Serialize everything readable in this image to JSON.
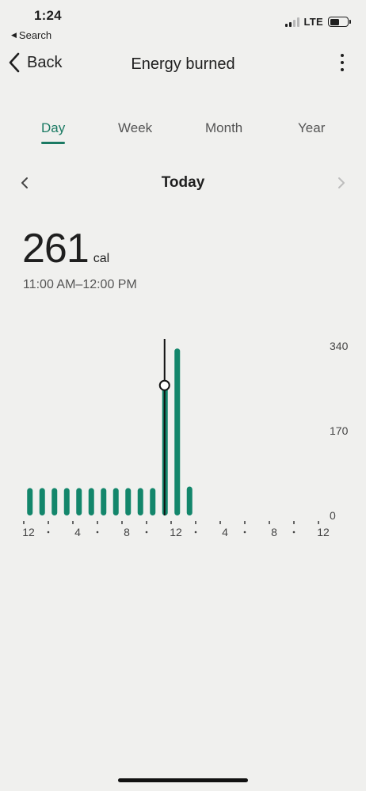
{
  "status_bar": {
    "time": "1:24",
    "back_app": "Search",
    "network": "LTE"
  },
  "header": {
    "back_label": "Back",
    "title": "Energy burned"
  },
  "tabs": [
    {
      "label": "Day",
      "active": true
    },
    {
      "label": "Week",
      "active": false
    },
    {
      "label": "Month",
      "active": false
    },
    {
      "label": "Year",
      "active": false
    }
  ],
  "date_nav": {
    "label": "Today"
  },
  "summary": {
    "value": "261",
    "unit": "cal",
    "range": "11:00 AM–12:00 PM"
  },
  "colors": {
    "accent": "#1b7a63",
    "bar": "#13866b"
  },
  "chart_data": {
    "type": "bar",
    "x": [
      0,
      1,
      2,
      3,
      4,
      5,
      6,
      7,
      8,
      9,
      10,
      11,
      12,
      13
    ],
    "values": [
      55,
      55,
      55,
      55,
      55,
      55,
      55,
      55,
      55,
      55,
      55,
      261,
      335,
      58
    ],
    "selected_index": 11,
    "x_tick_labels": [
      "12",
      "·",
      "4",
      "·",
      "8",
      "·",
      "12",
      "·",
      "4",
      "·",
      "8",
      "·",
      "12"
    ],
    "y_ticks": [
      0,
      170,
      340
    ],
    "y_tick_labels": [
      "0",
      "170",
      "340"
    ],
    "ylim": [
      0,
      340
    ],
    "xlim": [
      0,
      24
    ]
  }
}
